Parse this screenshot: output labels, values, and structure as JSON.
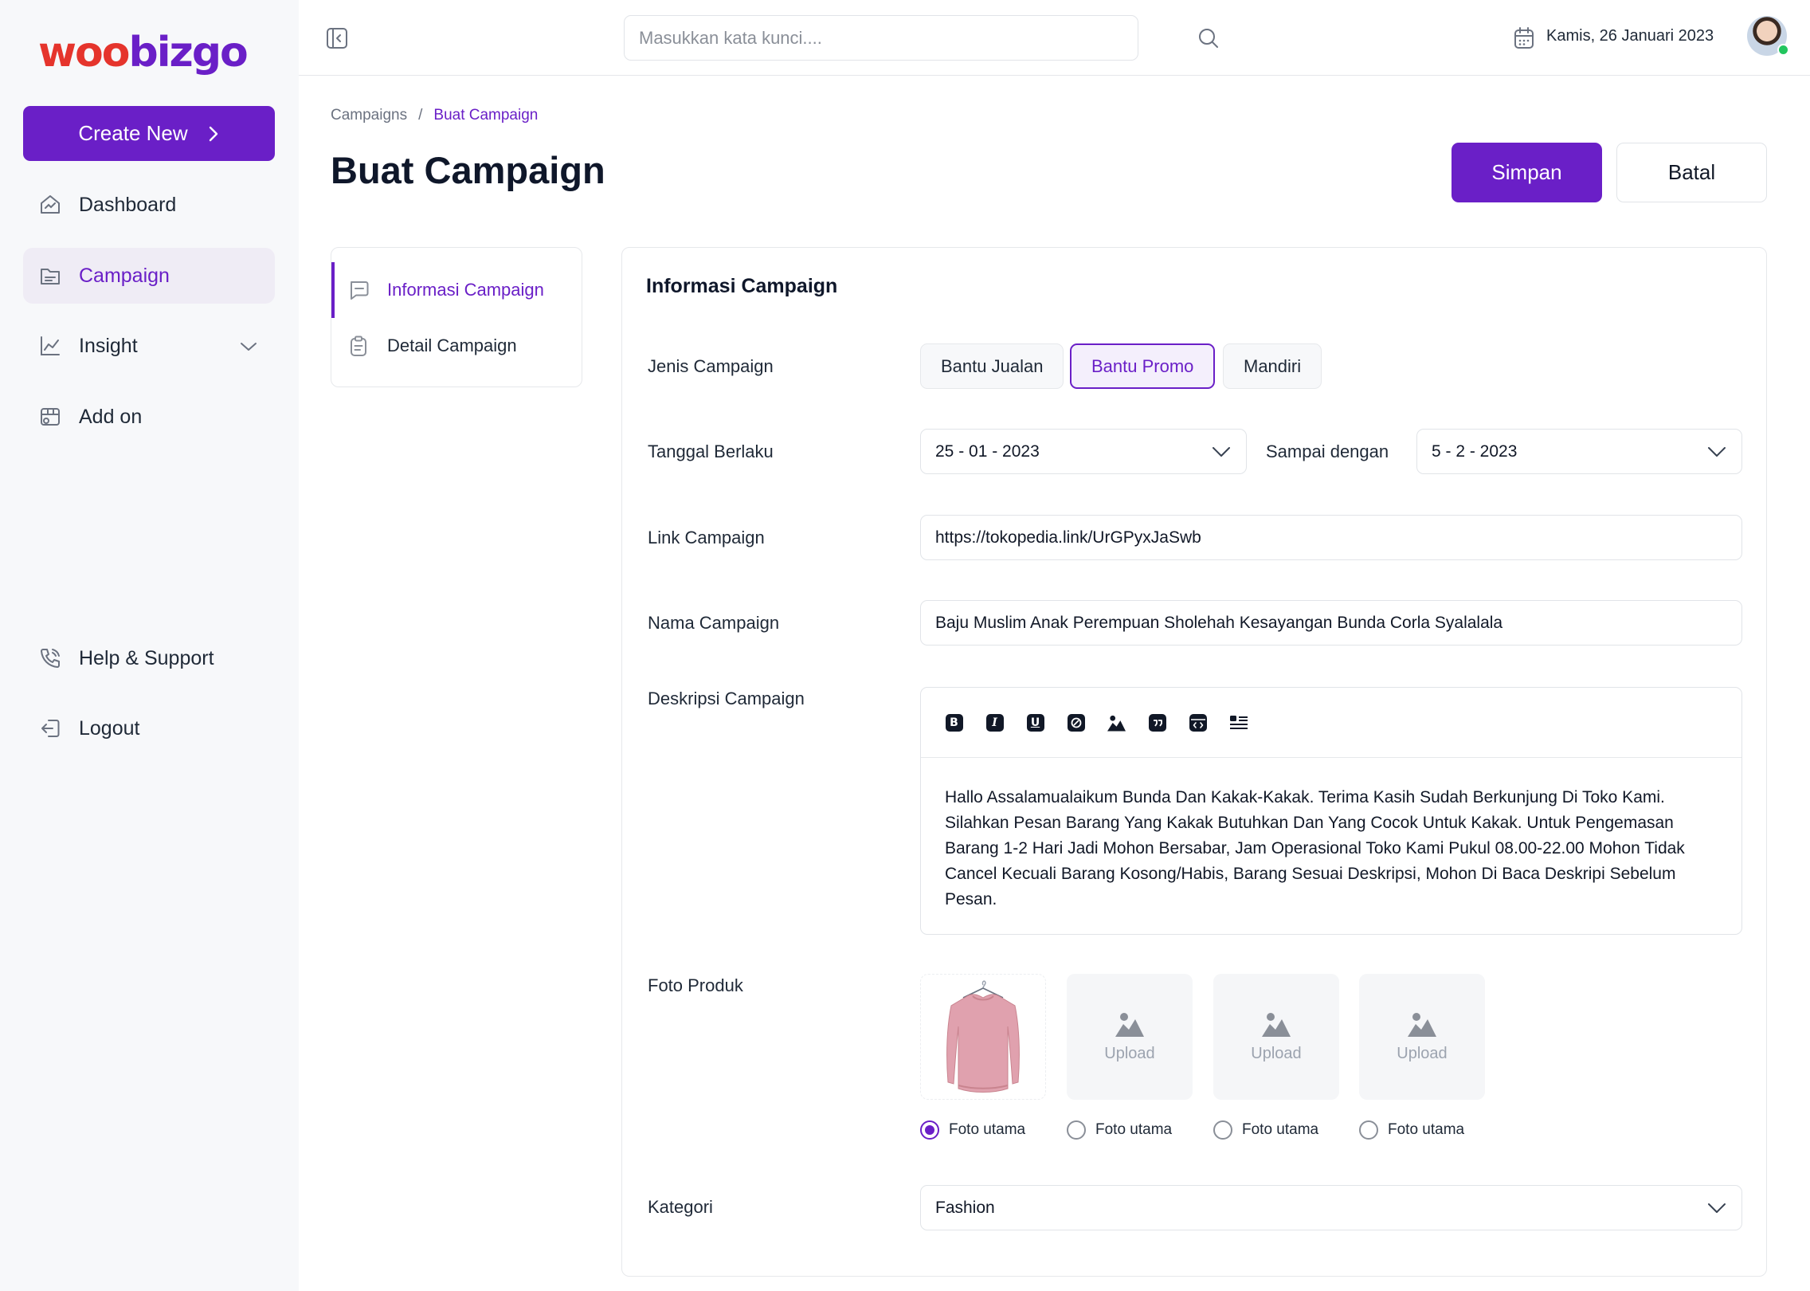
{
  "brand": {
    "logo_part1": "woo",
    "logo_part2": "bizgo",
    "primary_color": "#6a1fc7",
    "accent_color": "#e5342c"
  },
  "sidebar": {
    "create_label": "Create New",
    "items": [
      {
        "label": "Dashboard",
        "icon": "dashboard-icon"
      },
      {
        "label": "Campaign",
        "icon": "folder-icon",
        "active": true
      },
      {
        "label": "Insight",
        "icon": "chart-line-icon",
        "expandable": true
      },
      {
        "label": "Add on",
        "icon": "store-icon"
      }
    ],
    "bottom_items": [
      {
        "label": "Help & Support",
        "icon": "phone-icon"
      },
      {
        "label": "Logout",
        "icon": "logout-icon"
      }
    ]
  },
  "topbar": {
    "search_placeholder": "Masukkan kata kunci....",
    "date": "Kamis, 26 Januari 2023"
  },
  "breadcrumb": {
    "parent": "Campaigns",
    "separator": "/",
    "current": "Buat Campaign"
  },
  "page": {
    "title": "Buat Campaign",
    "save_label": "Simpan",
    "cancel_label": "Batal"
  },
  "section_nav": [
    {
      "label": "Informasi Campaign",
      "icon": "message-icon",
      "active": true
    },
    {
      "label": "Detail Campaign",
      "icon": "clipboard-icon"
    }
  ],
  "form": {
    "title": "Informasi Campaign",
    "jenis": {
      "label": "Jenis Campaign",
      "options": [
        "Bantu Jualan",
        "Bantu Promo",
        "Mandiri"
      ],
      "selected": "Bantu Promo"
    },
    "tanggal": {
      "label": "Tanggal Berlaku",
      "start": "25 - 01 - 2023",
      "until_label": "Sampai dengan",
      "end": "5 - 2 - 2023"
    },
    "link": {
      "label": "Link Campaign",
      "value": "https://tokopedia.link/UrGPyxJaSwb"
    },
    "nama": {
      "label": "Nama Campaign",
      "value": "Baju Muslim Anak Perempuan Sholehah Kesayangan Bunda Corla Syalalala"
    },
    "deskripsi": {
      "label": "Deskripsi Campaign",
      "toolbar": [
        "bold-icon",
        "italic-icon",
        "underline-icon",
        "link-icon",
        "image-icon",
        "quote-icon",
        "code-icon",
        "list-icon"
      ],
      "text": "Hallo Assalamualaikum Bunda Dan Kakak-Kakak. Terima Kasih Sudah Berkunjung Di Toko Kami. Silahkan Pesan Barang Yang Kakak Butuhkan Dan Yang Cocok Untuk Kakak. Untuk Pengemasan Barang 1-2 Hari Jadi Mohon Bersabar, Jam Operasional Toko Kami Pukul 08.00-22.00 Mohon Tidak Cancel Kecuali Barang Kosong/Habis, Barang Sesuai Deskripsi, Mohon Di Baca Deskripi Sebelum Pesan."
    },
    "foto": {
      "label": "Foto Produk",
      "upload_label": "Upload",
      "radio_label": "Foto utama",
      "slots": [
        {
          "filled": true,
          "primary": true
        },
        {
          "filled": false,
          "primary": false
        },
        {
          "filled": false,
          "primary": false
        },
        {
          "filled": false,
          "primary": false
        }
      ]
    },
    "kategori": {
      "label": "Kategori",
      "value": "Fashion"
    }
  }
}
